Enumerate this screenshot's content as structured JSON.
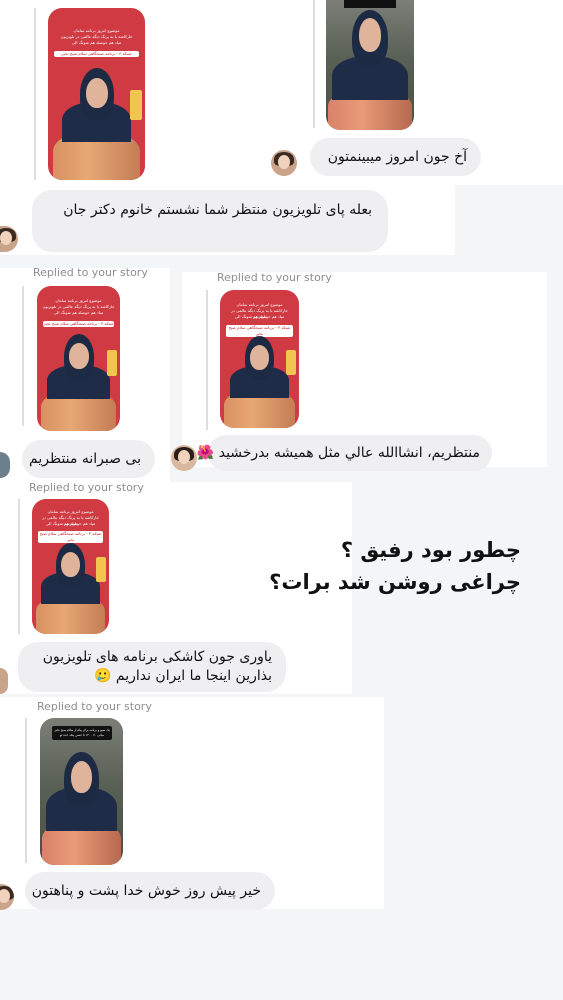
{
  "colors": {
    "background": "#f4f5f7",
    "card": "#ffffff",
    "bubble": "#efeff1",
    "label": "#8e8e8e",
    "story_red": "#cf3a43"
  },
  "story_caption": {
    "line1": "موضوع امروز برنامه سامان",
    "line2": "خاركاشه با به پرنگ دیگه عالمی در تلویزیون",
    "line3": "میاد هم حوصله هم شونگ الی",
    "band": "شبکه ۳ - برنامه صبحگاهی سلام صبح بخیر"
  },
  "car_story_caption": {
    "line1": "یک سیو و برنامه برای پیام از سلام صبح بخیر",
    "line2": "میانی ۷۰ ۱۴۰۰ تا حسن پنکه حده تو"
  },
  "replied_label": "Replied to your story",
  "messages": [
    {
      "text": "آخ جون امروز میبینمتون"
    },
    {
      "text": "بعله پای تلویزیون منتظر شما نشستم خانوم دکتر جان"
    },
    {
      "text": "بی صبرانه منتظریم"
    },
    {
      "text": "منتظریم، انشاالله عالي مثل همیشه بدرخشید",
      "emoji": "🌺",
      "emoji_name": "hibiscus-emoji"
    },
    {
      "text": "یاوری جون کاشکی برنامه های تلویزیون بذارین اینجا ما ایران نداریم",
      "emoji": "🥲",
      "emoji_name": "smiling-tear-emoji"
    },
    {
      "text": "خیر پیش روز خوش خدا پشت و پناهتون"
    }
  ],
  "overlay": {
    "line1": "چطور بود رفیق ؟",
    "line2": "چراغی روشن شد برات؟"
  }
}
